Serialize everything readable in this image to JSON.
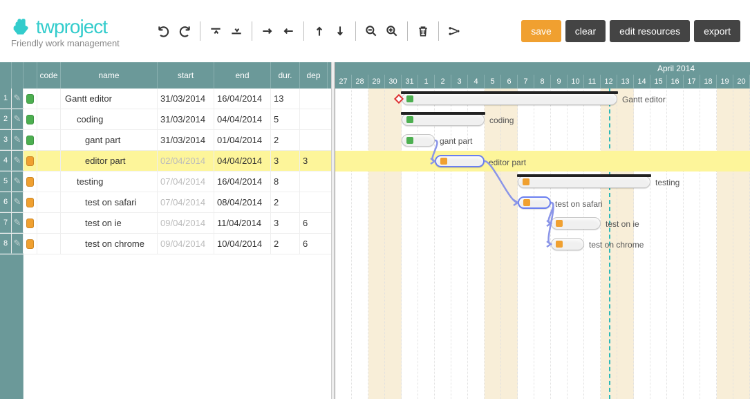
{
  "brand": {
    "name": "twproject",
    "tagline": "Friendly work management"
  },
  "toolbar": {
    "save": "save",
    "clear": "clear",
    "editResources": "edit resources",
    "export": "export"
  },
  "columns": {
    "code": "code",
    "name": "name",
    "start": "start",
    "end": "end",
    "dur": "dur.",
    "dep": "dep"
  },
  "monthLabel": "April 2014",
  "days": [
    "27",
    "28",
    "29",
    "30",
    "31",
    "1",
    "2",
    "3",
    "4",
    "5",
    "6",
    "7",
    "8",
    "9",
    "10",
    "11",
    "12",
    "13",
    "14",
    "15",
    "16",
    "17",
    "18",
    "19",
    "20"
  ],
  "weekendIdx": [
    2,
    3,
    9,
    10,
    16,
    17,
    23,
    24
  ],
  "todayIdx": 16,
  "tasks": [
    {
      "num": "1",
      "status": "green",
      "name": "Gantt editor",
      "indent": 0,
      "start": "31/03/2014",
      "end": "16/04/2014",
      "dur": "13",
      "dep": "",
      "startFaded": false,
      "barStart": 4,
      "barLen": 13,
      "parent": true,
      "milestone": true
    },
    {
      "num": "2",
      "status": "green",
      "name": "coding",
      "indent": 1,
      "start": "31/03/2014",
      "end": "04/04/2014",
      "dur": "5",
      "dep": "",
      "startFaded": false,
      "barStart": 4,
      "barLen": 5,
      "parent": true
    },
    {
      "num": "3",
      "status": "green",
      "name": "gant part",
      "indent": 2,
      "start": "31/03/2014",
      "end": "01/04/2014",
      "dur": "2",
      "dep": "",
      "startFaded": false,
      "barStart": 4,
      "barLen": 2
    },
    {
      "num": "4",
      "status": "orange",
      "name": "editor part",
      "indent": 2,
      "start": "02/04/2014",
      "end": "04/04/2014",
      "dur": "3",
      "dep": "3",
      "startFaded": true,
      "barStart": 6,
      "barLen": 3,
      "selected": true
    },
    {
      "num": "5",
      "status": "orange",
      "name": "testing",
      "indent": 1,
      "start": "07/04/2014",
      "end": "16/04/2014",
      "dur": "8",
      "dep": "",
      "startFaded": true,
      "barStart": 11,
      "barLen": 8,
      "parent": true
    },
    {
      "num": "6",
      "status": "orange",
      "name": "test on safari",
      "indent": 2,
      "start": "07/04/2014",
      "end": "08/04/2014",
      "dur": "2",
      "dep": "",
      "startFaded": true,
      "barStart": 11,
      "barLen": 2,
      "selected": true
    },
    {
      "num": "7",
      "status": "orange",
      "name": "test on ie",
      "indent": 2,
      "start": "09/04/2014",
      "end": "11/04/2014",
      "dur": "3",
      "dep": "6",
      "startFaded": true,
      "barStart": 13,
      "barLen": 3
    },
    {
      "num": "8",
      "status": "orange",
      "name": "test on chrome",
      "indent": 2,
      "start": "09/04/2014",
      "end": "10/04/2014",
      "dur": "2",
      "dep": "6",
      "startFaded": true,
      "barStart": 13,
      "barLen": 2
    }
  ]
}
